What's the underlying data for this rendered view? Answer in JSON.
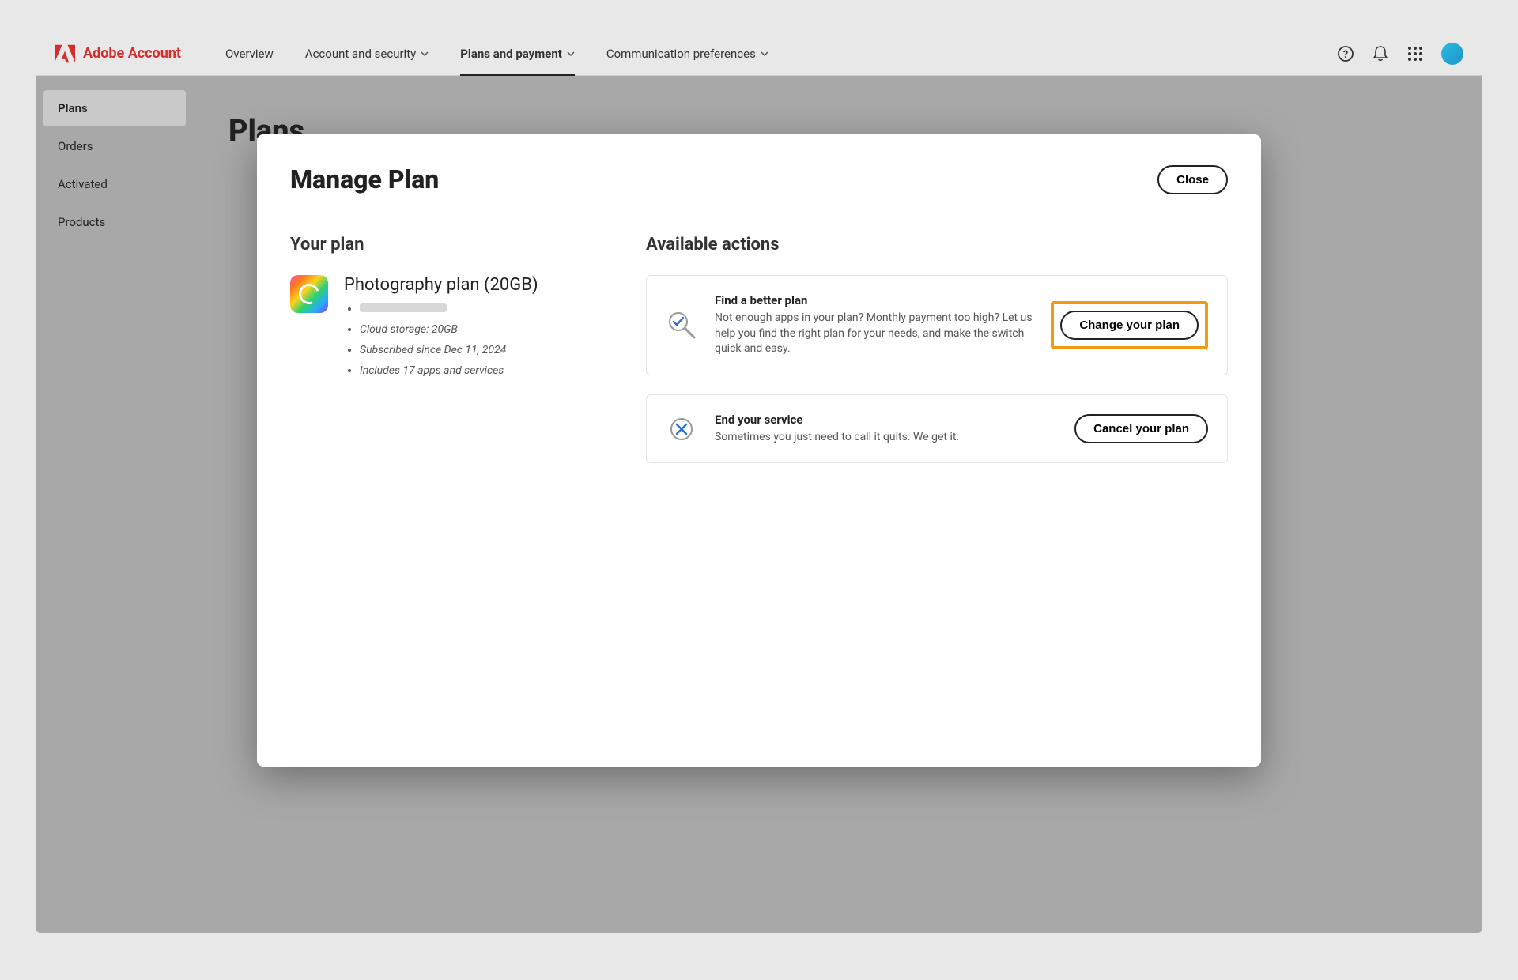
{
  "brand": {
    "name": "Adobe Account"
  },
  "nav": {
    "overview": "Overview",
    "account_security": "Account and security",
    "plans_payment": "Plans and payment",
    "communication": "Communication preferences"
  },
  "sidebar": {
    "plans": "Plans",
    "orders": "Orders",
    "activated": "Activated",
    "products": "Products"
  },
  "page": {
    "title": "Plans"
  },
  "modal": {
    "title": "Manage Plan",
    "close": "Close",
    "your_plan_heading": "Your plan",
    "plan_name": "Photography plan (20GB)",
    "details": {
      "storage": "Cloud storage: 20GB",
      "since": "Subscribed since Dec 11, 2024",
      "includes": "Includes 17 apps and services"
    },
    "actions_heading": "Available actions",
    "find_better": {
      "title": "Find a better plan",
      "desc": "Not enough apps in your plan? Monthly payment too high? Let us help you find the right plan for your needs, and make the switch quick and easy.",
      "button": "Change your plan"
    },
    "end_service": {
      "title": "End your service",
      "desc": "Sometimes you just need to call it quits. We get it.",
      "button": "Cancel your plan"
    }
  }
}
